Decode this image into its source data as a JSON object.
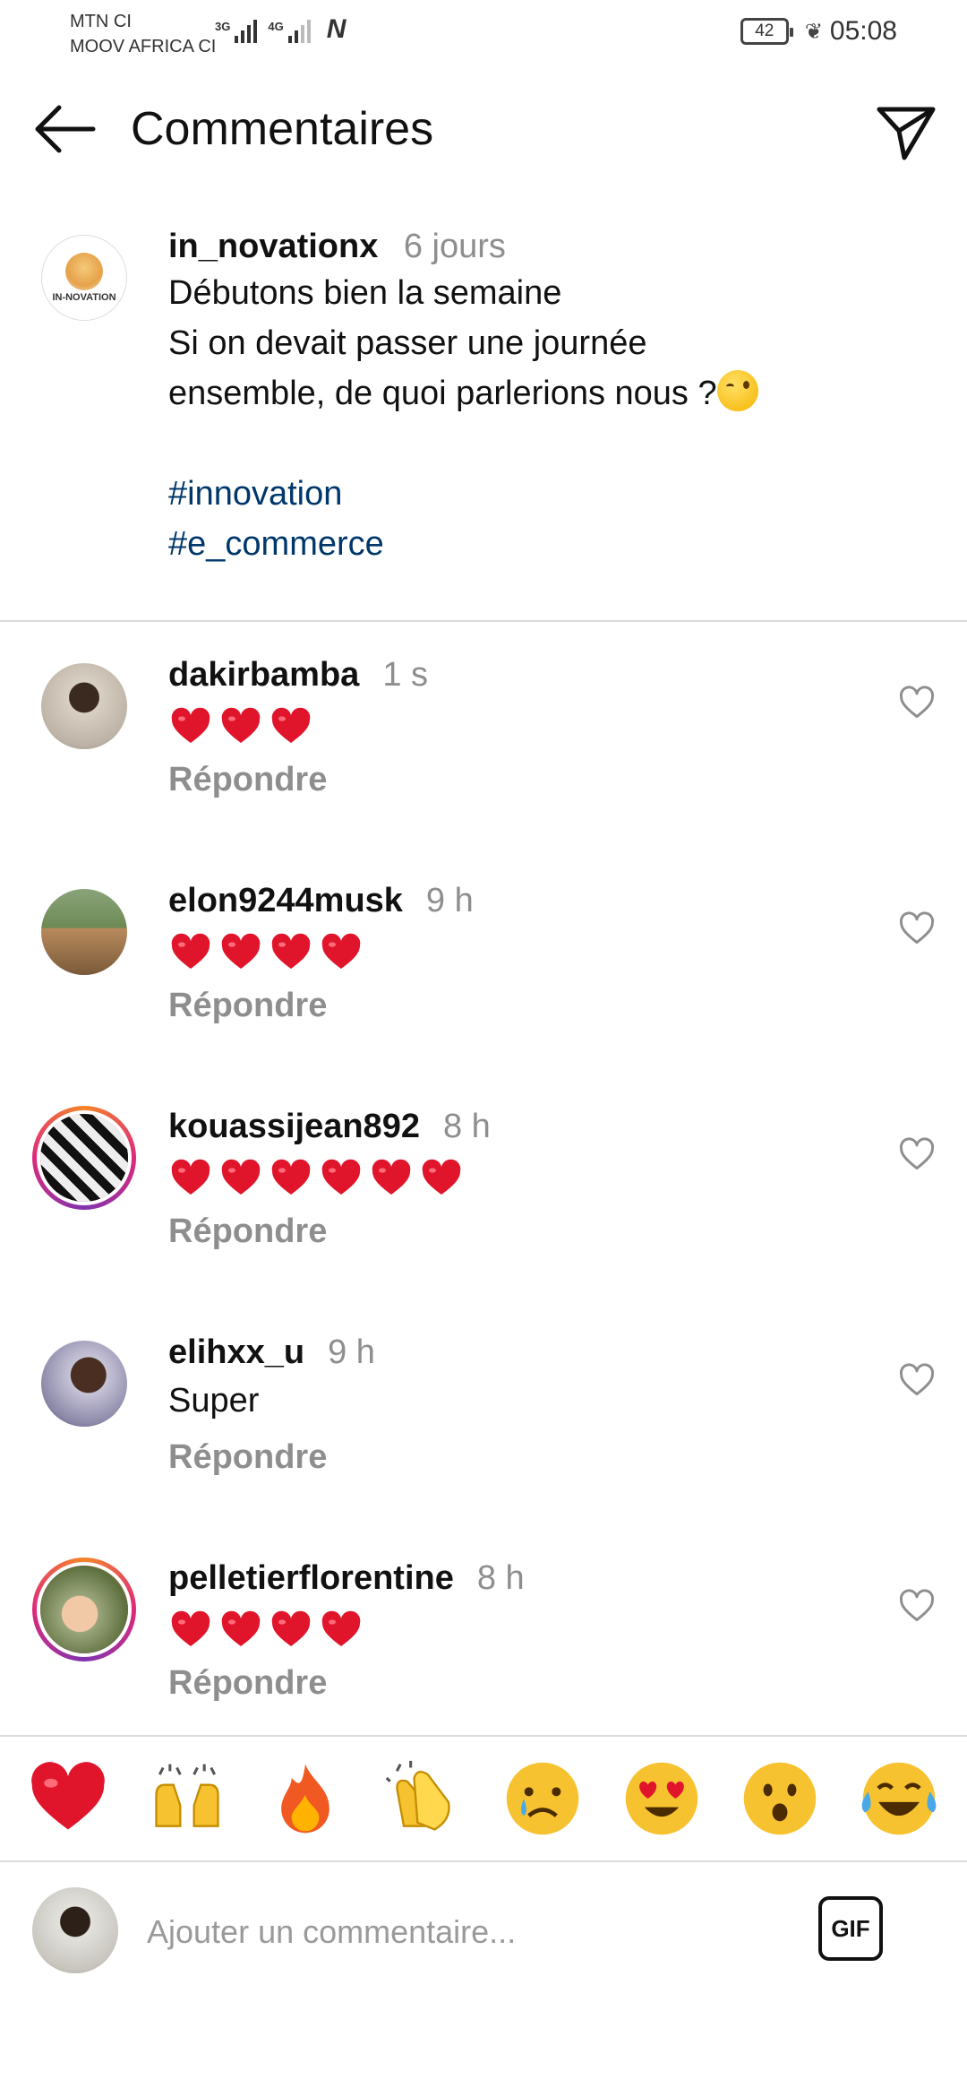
{
  "status_bar": {
    "carrier_1": "MTN CI",
    "carrier_2": "MOOV AFRICA CI",
    "network_1": "3G",
    "network_2": "4G",
    "battery": "42",
    "time": "05:08"
  },
  "header": {
    "title": "Commentaires",
    "back_icon": "arrow-left-icon",
    "send_icon": "paper-plane-icon"
  },
  "post": {
    "username": "in_novationx",
    "time_ago": "6 jours",
    "avatar_text": "IN-NOVATION",
    "caption_line_1": "Débutons bien la semaine",
    "caption_line_2": "Si on devait passer une journée",
    "caption_line_3": "ensemble, de quoi parlerions nous ?",
    "hashtags": [
      "#innovation",
      "#e_commerce"
    ]
  },
  "comments": [
    {
      "username": "dakirbamba",
      "time": "1 s",
      "text": "",
      "hearts": 3,
      "reply": "Répondre"
    },
    {
      "username": "elon9244musk",
      "time": "9 h",
      "text": "",
      "hearts": 4,
      "reply": "Répondre"
    },
    {
      "username": "kouassijean892",
      "time": "8 h",
      "text": "",
      "hearts": 6,
      "reply": "Répondre"
    },
    {
      "username": "elihxx_u",
      "time": "9 h",
      "text": "Super",
      "hearts": 0,
      "reply": "Répondre"
    },
    {
      "username": "pelletierflorentine",
      "time": "8 h",
      "text": "",
      "hearts": 4,
      "reply": "Répondre"
    }
  ],
  "emoji_bar": [
    "heart-emoji",
    "raising-hands-emoji",
    "fire-emoji",
    "clapping-hands-emoji",
    "crying-face-emoji",
    "heart-eyes-emoji",
    "surprised-face-emoji",
    "tears-of-joy-emoji"
  ],
  "input": {
    "placeholder": "Ajouter un commentaire...",
    "gif_label": "GIF"
  },
  "colors": {
    "hashtag": "#00376b",
    "muted": "#8e8e8e",
    "heart_red": "#e0152b",
    "divider": "#dbdbdb"
  }
}
